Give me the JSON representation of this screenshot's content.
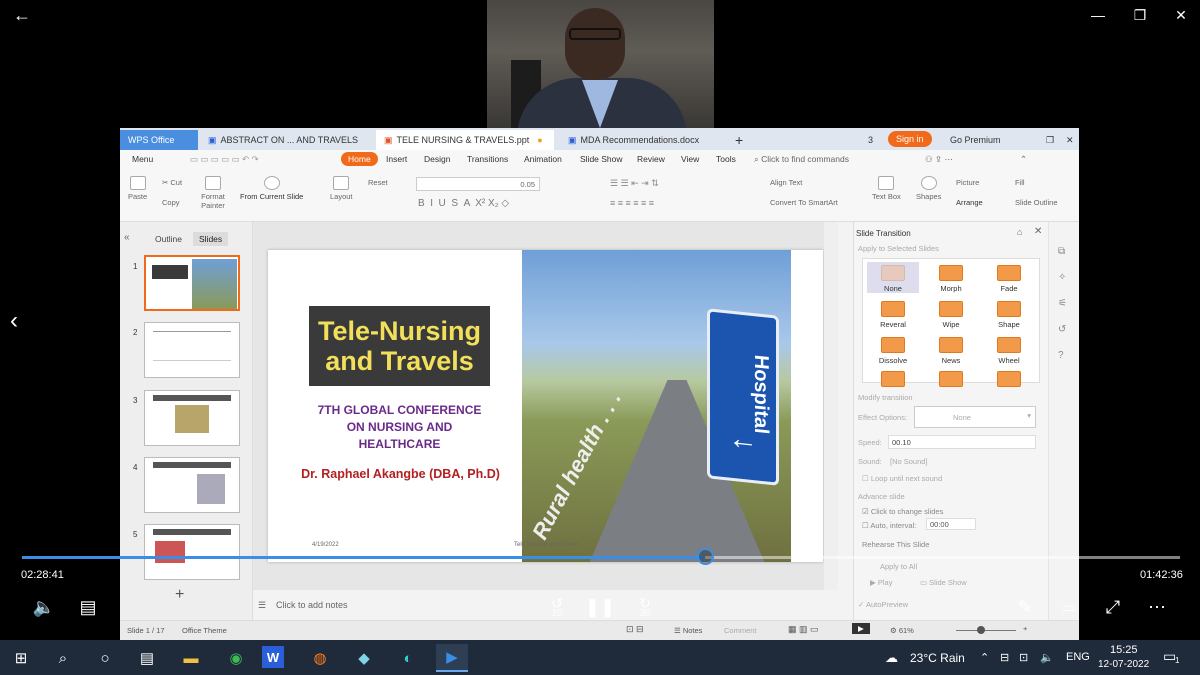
{
  "player": {
    "back_icon": "back-arrow-icon",
    "elapsed": "02:28:41",
    "remaining": "01:42:36",
    "progress_fraction": 0.59,
    "controls": {
      "skip_back": "10",
      "skip_forward": "30"
    }
  },
  "wps": {
    "tabs": [
      "WPS Office",
      "ABSTRACT ON ... AND TRAVELS",
      "TELE NURSING & TRAVELS.ppt",
      "MDA Recommendations.docx"
    ],
    "new_tab": "+",
    "sign_in": "Sign in",
    "go_premium": "Go Premium",
    "menu": [
      "Menu",
      "Home",
      "Insert",
      "Design",
      "Transitions",
      "Animation",
      "Slide Show",
      "Review",
      "View",
      "Tools"
    ],
    "find": "Click to find commands",
    "ribbon": {
      "paste": "Paste",
      "cut": "Cut",
      "copy": "Copy",
      "format_painter": "Format Painter",
      "from_current": "From Current Slide",
      "layout": "Layout",
      "reset": "Reset",
      "align_text": "Align Text",
      "convert": "Convert To SmartArt",
      "text_box": "Text Box",
      "shapes": "Shapes",
      "picture": "Picture",
      "fill": "Fill",
      "arrange": "Arrange",
      "slide_outline": "Slide Outline",
      "font_size": "0.05"
    },
    "panel_tabs": [
      "Outline",
      "Slides"
    ],
    "slide_numbers": [
      "1",
      "2",
      "3",
      "4",
      "5"
    ],
    "notes": "Click to add notes",
    "status": {
      "slide": "Slide 1 / 17",
      "theme": "Office Theme",
      "notes": "Notes",
      "comment": "Comment",
      "zoom": "61%"
    }
  },
  "slide": {
    "title": "Tele-Nursing and Travels",
    "conference": "7TH GLOBAL CONFERENCE ON NURSING AND HEALTHCARE",
    "author": "Dr. Raphael Akangbe (DBA, Ph.D)",
    "sign_text": "Hospital",
    "rural": "Rural health . . .",
    "date": "4/19/2022",
    "footer": "Tele Nursing and Travel"
  },
  "transition": {
    "title": "Slide Transition",
    "apply_selected": "Apply to Selected Slides",
    "effects": [
      "None",
      "Morph",
      "Fade",
      "Reveral",
      "Wipe",
      "Shape",
      "Dissolve",
      "News",
      "Wheel"
    ],
    "modify": "Modify transition",
    "effect_options_label": "Effect Options:",
    "effect_options_value": "None",
    "speed_label": "Speed:",
    "speed_value": "00.10",
    "sound_label": "Sound:",
    "sound_value": "[No Sound]",
    "loop": "Loop until next sound",
    "advance": "Advance slide",
    "click_change": "Click to change slides",
    "auto_label": "Auto, interval:",
    "auto_value": "00:00",
    "rehearse": "Rehearse This Slide",
    "apply_all": "Apply to All",
    "play": "Play",
    "slide_show": "Slide Show",
    "autopreview": "AutoPreview"
  },
  "taskbar": {
    "weather": "23°C Rain",
    "lang": "ENG",
    "time": "15:25",
    "date": "12-07-2022",
    "notif": "1"
  }
}
